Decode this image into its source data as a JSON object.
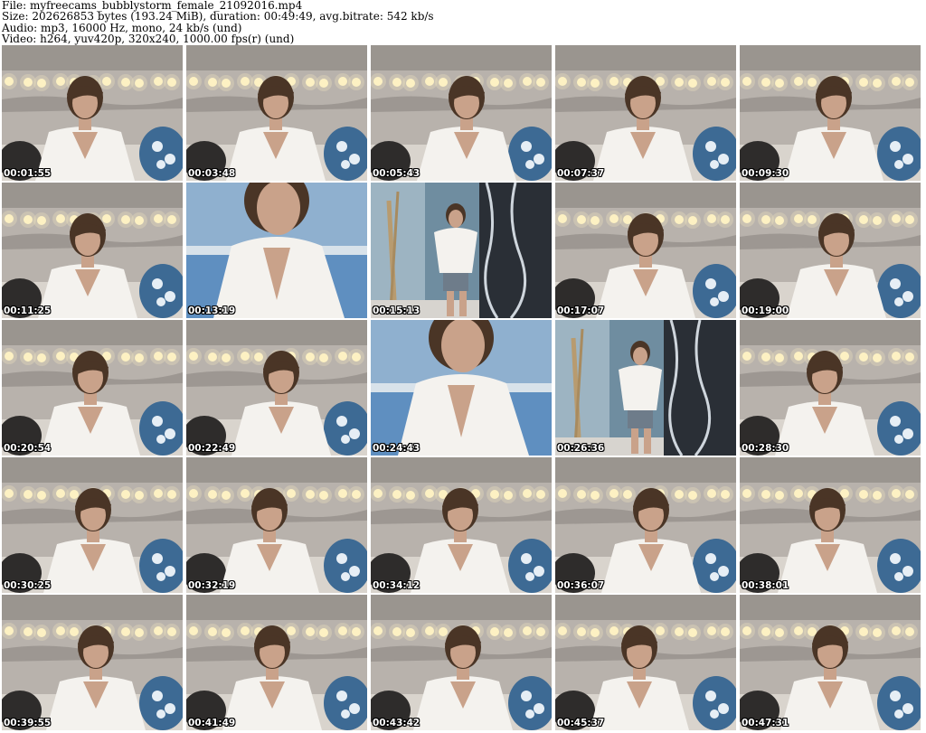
{
  "header": {
    "file": "File: myfreecams_bubblystorm_female_21092016.mp4",
    "size": "Size: 202626853 bytes (193.24 MiB), duration: 00:49:49, avg.bitrate: 542 kb/s",
    "audio": "Audio: mp3, 16000 Hz, mono, 24 kb/s (und)",
    "video": "Video: h264, yuv420p, 320x240, 1000.00 fps(r) (und)"
  },
  "thumbnails": [
    {
      "timestamp": "00:01:55",
      "scene": "room"
    },
    {
      "timestamp": "00:03:48",
      "scene": "room"
    },
    {
      "timestamp": "00:05:43",
      "scene": "room"
    },
    {
      "timestamp": "00:07:37",
      "scene": "room"
    },
    {
      "timestamp": "00:09:30",
      "scene": "room"
    },
    {
      "timestamp": "00:11:25",
      "scene": "room"
    },
    {
      "timestamp": "00:13:19",
      "scene": "closeup"
    },
    {
      "timestamp": "00:15:13",
      "scene": "standing"
    },
    {
      "timestamp": "00:17:07",
      "scene": "room"
    },
    {
      "timestamp": "00:19:00",
      "scene": "room"
    },
    {
      "timestamp": "00:20:54",
      "scene": "room"
    },
    {
      "timestamp": "00:22:49",
      "scene": "room"
    },
    {
      "timestamp": "00:24:43",
      "scene": "closeup"
    },
    {
      "timestamp": "00:26:36",
      "scene": "standing"
    },
    {
      "timestamp": "00:28:30",
      "scene": "room"
    },
    {
      "timestamp": "00:30:25",
      "scene": "room"
    },
    {
      "timestamp": "00:32:19",
      "scene": "room"
    },
    {
      "timestamp": "00:34:12",
      "scene": "room"
    },
    {
      "timestamp": "00:36:07",
      "scene": "room"
    },
    {
      "timestamp": "00:38:01",
      "scene": "room"
    },
    {
      "timestamp": "00:39:55",
      "scene": "room"
    },
    {
      "timestamp": "00:41:49",
      "scene": "room"
    },
    {
      "timestamp": "00:43:42",
      "scene": "room"
    },
    {
      "timestamp": "00:45:37",
      "scene": "room"
    },
    {
      "timestamp": "00:47:31",
      "scene": "room"
    }
  ],
  "colors": {
    "background": "#ffffff",
    "text": "#000000",
    "timestamp_text": "#ffffff",
    "wall": "#b8b2ac",
    "lights": "#fff3c4",
    "dress": "#f4f2ee",
    "hair": "#4a3526",
    "skin": "#c9a28a",
    "pillow_blue": "#3d6a94",
    "curtain_dark": "#2a2f36",
    "ocean_blue": "#5f8fc0"
  }
}
